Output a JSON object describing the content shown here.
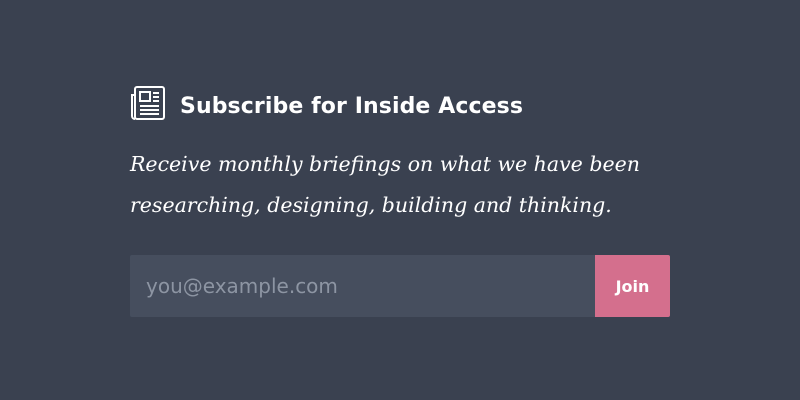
{
  "subscribe": {
    "icon": "newspaper-icon",
    "title": "Subscribe for Inside Access",
    "description": "Receive monthly briefings on what we have been researching, designing, building and thinking.",
    "email_placeholder": "you@example.com",
    "email_value": "",
    "join_label": "Join"
  },
  "colors": {
    "background": "#3a4150",
    "input_background": "#464e5e",
    "button_background": "#d46f8d",
    "text": "#ffffff",
    "placeholder": "#8d95a3"
  }
}
